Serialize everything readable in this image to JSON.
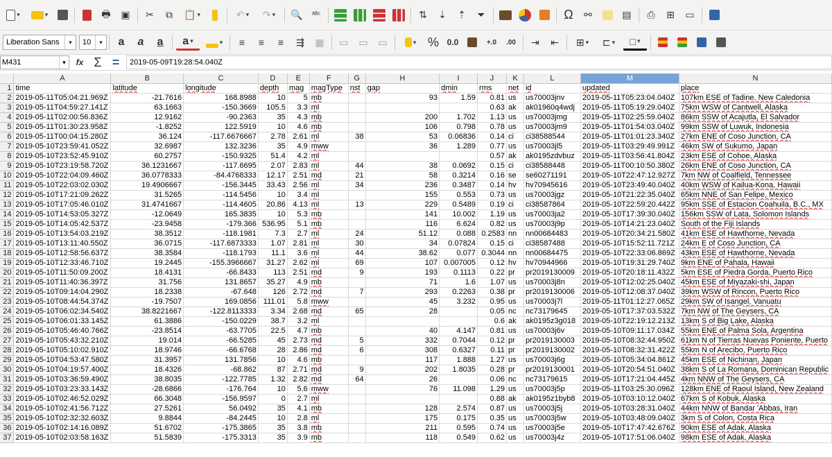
{
  "toolbar1": {
    "icons": [
      "new-icon",
      "open-icon",
      "save-icon",
      "pdf-icon",
      "print-icon",
      "print-preview-icon",
      "cut-icon",
      "copy-icon",
      "paste-icon",
      "clone-format-icon",
      "undo-icon",
      "redo-icon",
      "find-replace-icon",
      "spelling-icon",
      "row-icon",
      "column-icon",
      "insert-rows-icon",
      "insert-columns-icon",
      "sort-icon",
      "sort-ascending-icon",
      "sort-descending-icon",
      "autofilter-icon",
      "image-icon",
      "chart-icon",
      "pivot-table-icon",
      "special-character-icon",
      "hyperlink-icon",
      "comment-icon",
      "header-footer-icon",
      "define-print-area-icon",
      "freeze-rows-icon",
      "split-window-icon",
      "show-draw-icon"
    ],
    "colors": {
      "green": "#3a9b3a",
      "red": "#c33",
      "blue": "#3465a4",
      "yellow": "#f5c211"
    }
  },
  "toolbar2": {
    "font_name": "Liberation Sans",
    "font_size": "10",
    "percent_label": "%",
    "number_label": "0.0"
  },
  "formula_bar": {
    "cell_ref": "M431",
    "sum_symbol": "Σ",
    "eq_symbol": "=",
    "fx_symbol": "fx",
    "content": "2019-05-09T19:28:54.040Z"
  },
  "grid": {
    "selected_column": "M",
    "columns": [
      {
        "letter": "A",
        "w": 140
      },
      {
        "letter": "B",
        "w": 105
      },
      {
        "letter": "C",
        "w": 108
      },
      {
        "letter": "D",
        "w": 42
      },
      {
        "letter": "E",
        "w": 32
      },
      {
        "letter": "F",
        "w": 56
      },
      {
        "letter": "G",
        "w": 25
      },
      {
        "letter": "H",
        "w": 107
      },
      {
        "letter": "I",
        "w": 55
      },
      {
        "letter": "J",
        "w": 42
      },
      {
        "letter": "K",
        "w": 25
      },
      {
        "letter": "L",
        "w": 82
      },
      {
        "letter": "M",
        "w": 142
      },
      {
        "letter": "N",
        "w": 220
      }
    ],
    "rows": [
      {
        "n": "1",
        "c": [
          "time",
          "latitude",
          "longitude",
          "depth",
          "mag",
          "magType",
          "nst",
          "gap",
          "dmin",
          "rms",
          "net",
          "id",
          "updated",
          "place"
        ]
      },
      {
        "n": "2",
        "c": [
          "2019-05-11T05:04:21.969Z",
          "-21.7616",
          "168.8988",
          "10",
          "5",
          "mb",
          "",
          "93",
          "1.59",
          "0.81",
          "us",
          "us70003jnv",
          "2019-05-11T05:23:04.040Z",
          "107km ESE of Tadine, New Caledonia"
        ]
      },
      {
        "n": "3",
        "c": [
          "2019-05-11T04:59:27.141Z",
          "63.1663",
          "-150.3669",
          "105.5",
          "3.3",
          "ml",
          "",
          "",
          "",
          "0.63",
          "ak",
          "ak01960q4wdj",
          "2019-05-11T05:19:29.040Z",
          "75km WSW of Cantwell, Alaska"
        ]
      },
      {
        "n": "4",
        "c": [
          "2019-05-11T02:00:56.836Z",
          "12.9162",
          "-90.2363",
          "35",
          "4.3",
          "mb",
          "",
          "200",
          "1.702",
          "1.13",
          "us",
          "us70003jmg",
          "2019-05-11T02:25:59.040Z",
          "86km SSW of Acajutla, El Salvador"
        ]
      },
      {
        "n": "5",
        "c": [
          "2019-05-11T01:30:23.958Z",
          "-1.8252",
          "122.5919",
          "10",
          "4.6",
          "mb",
          "",
          "106",
          "0.798",
          "0.78",
          "us",
          "us70003jm9",
          "2019-05-11T01:54:03.040Z",
          "99km SSW of Luwuk, Indonesia"
        ]
      },
      {
        "n": "6",
        "c": [
          "2019-05-11T00:04:15.280Z",
          "36.124",
          "-117.6676667",
          "2.78",
          "2.61",
          "ml",
          "38",
          "53",
          "0.06836",
          "0.14",
          "ci",
          "ci38588544",
          "2019-05-11T01:01:23.340Z",
          "27km ENE of Coso Junction, CA"
        ]
      },
      {
        "n": "7",
        "c": [
          "2019-05-10T23:59:41.052Z",
          "32.6987",
          "132.3236",
          "35",
          "4.9",
          "mww",
          "",
          "36",
          "1.289",
          "0.77",
          "us",
          "us70003jl5",
          "2019-05-11T03:29:49.991Z",
          "46km SW of Sukumo, Japan"
        ]
      },
      {
        "n": "8",
        "c": [
          "2019-05-10T23:52:45.910Z",
          "60.2757",
          "-150.9325",
          "51.4",
          "4.2",
          "ml",
          "",
          "",
          "",
          "0.57",
          "ak",
          "ak0195zdvbuz",
          "2019-05-11T03:56:41.804Z",
          "23km ESE of Cohoe, Alaska"
        ]
      },
      {
        "n": "9",
        "c": [
          "2019-05-10T23:19:58.720Z",
          "36.1231667",
          "-117.6695",
          "2.07",
          "2.83",
          "ml",
          "44",
          "38",
          "0.0692",
          "0.15",
          "ci",
          "ci38588448",
          "2019-05-11T00:10:50.380Z",
          "26km ENE of Coso Junction, CA"
        ]
      },
      {
        "n": "10",
        "c": [
          "2019-05-10T22:04:09.460Z",
          "36.0778333",
          "-84.4768333",
          "12.17",
          "2.51",
          "md",
          "21",
          "58",
          "0.3214",
          "0.16",
          "se",
          "se60271191",
          "2019-05-10T22:47:12.927Z",
          "7km NW of Coalfield, Tennessee"
        ]
      },
      {
        "n": "11",
        "c": [
          "2019-05-10T22:03:02.030Z",
          "19.4906667",
          "-156.3445",
          "33.43",
          "2.56",
          "ml",
          "34",
          "236",
          "0.3487",
          "0.14",
          "hv",
          "hv70945616",
          "2019-05-10T23:49:40.040Z",
          "40km WSW of Kailua-Kona, Hawaii"
        ]
      },
      {
        "n": "12",
        "c": [
          "2019-05-10T17:21:09.262Z",
          "31.5265",
          "-114.5456",
          "10",
          "3.4",
          "ml",
          "",
          "155",
          "0.553",
          "0.73",
          "us",
          "us70003jgz",
          "2019-05-10T21:22:35.040Z",
          "65km NNE of San Felipe, Mexico"
        ]
      },
      {
        "n": "13",
        "c": [
          "2019-05-10T17:05:46.010Z",
          "31.4741667",
          "-114.4605",
          "20.86",
          "4.13",
          "ml",
          "13",
          "229",
          "0.5489",
          "0.19",
          "ci",
          "ci38587864",
          "2019-05-10T22:59:20.442Z",
          "95km SSE of Estacion Coahuila, B.C., MX"
        ]
      },
      {
        "n": "14",
        "c": [
          "2019-05-10T14:53:05.327Z",
          "-12.0649",
          "165.3835",
          "10",
          "5.3",
          "mb",
          "",
          "141",
          "10.002",
          "1.19",
          "us",
          "us70003ja2",
          "2019-05-10T17:39:30.040Z",
          "156km SSW of Lata, Solomon Islands"
        ]
      },
      {
        "n": "15",
        "c": [
          "2019-05-10T14:05:42.537Z",
          "-23.9458",
          "-179.366",
          "536.95",
          "5.1",
          "mb",
          "",
          "116",
          "6.624",
          "0.82",
          "us",
          "us70003j9p",
          "2019-05-10T14:21:23.040Z",
          "South of the Fiji Islands"
        ]
      },
      {
        "n": "16",
        "c": [
          "2019-05-10T13:54:03.219Z",
          "38.3512",
          "-118.1981",
          "7.3",
          "2.7",
          "ml",
          "24",
          "51.12",
          "0.088",
          "0.2583",
          "nn",
          "nn00684483",
          "2019-05-10T20:34:21.580Z",
          "41km ESE of Hawthorne, Nevada"
        ]
      },
      {
        "n": "17",
        "c": [
          "2019-05-10T13:11:40.550Z",
          "36.0715",
          "-117.6873333",
          "1.07",
          "2.81",
          "ml",
          "30",
          "34",
          "0.07824",
          "0.15",
          "ci",
          "ci38587488",
          "2019-05-10T15:52:11.721Z",
          "24km E of Coso Junction, CA"
        ]
      },
      {
        "n": "18",
        "c": [
          "2019-05-10T12:58:56.637Z",
          "38.3584",
          "-118.1793",
          "11.1",
          "3.6",
          "ml",
          "44",
          "38.62",
          "0.077",
          "0.3044",
          "nn",
          "nn00684475",
          "2019-05-10T22:33:06.869Z",
          "43km ESE of Hawthorne, Nevada"
        ]
      },
      {
        "n": "19",
        "c": [
          "2019-05-10T12:33:46.710Z",
          "19.2445",
          "-155.3966667",
          "31.27",
          "2.62",
          "ml",
          "69",
          "107",
          "0.007005",
          "0.12",
          "hv",
          "hv70944966",
          "2019-05-10T19:31:29.740Z",
          "9km ENE of Pahala, Hawaii"
        ]
      },
      {
        "n": "20",
        "c": [
          "2019-05-10T11:50:09.200Z",
          "18.4131",
          "-66.8433",
          "113",
          "2.51",
          "md",
          "9",
          "193",
          "0.1113",
          "0.22",
          "pr",
          "pr2019130009",
          "2019-05-10T20:18:11.432Z",
          "5km ESE of Piedra Gorda, Puerto Rico"
        ]
      },
      {
        "n": "21",
        "c": [
          "2019-05-10T11:40:36.397Z",
          "31.756",
          "131.8657",
          "35.27",
          "4.9",
          "mb",
          "",
          "71",
          "1.6",
          "1.07",
          "us",
          "us70003j8n",
          "2019-05-10T12:02:25.040Z",
          "45km ESE of Miyazaki-shi, Japan"
        ]
      },
      {
        "n": "22",
        "c": [
          "2019-05-10T09:14:04.290Z",
          "18.2338",
          "-67.648",
          "126",
          "2.72",
          "md",
          "7",
          "293",
          "0.2263",
          "0.38",
          "pr",
          "pr2019130006",
          "2019-05-10T12:08:37.040Z",
          "39km WSW of Rincon, Puerto Rico"
        ]
      },
      {
        "n": "23",
        "c": [
          "2019-05-10T08:44:54.374Z",
          "-19.7507",
          "169.0856",
          "111.01",
          "5.8",
          "mww",
          "",
          "45",
          "3.232",
          "0.95",
          "us",
          "us70003j7l",
          "2019-05-11T01:12:27.065Z",
          "29km SW of Isangel, Vanuatu"
        ]
      },
      {
        "n": "24",
        "c": [
          "2019-05-10T06:02:34.540Z",
          "38.8221667",
          "-122.8113333",
          "3.34",
          "2.68",
          "md",
          "65",
          "28",
          "",
          "0.05",
          "nc",
          "nc73179645",
          "2019-05-10T17:37:03.532Z",
          "7km NW of The Geysers, CA"
        ]
      },
      {
        "n": "25",
        "c": [
          "2019-05-10T06:01:33.145Z",
          "61.3886",
          "-150.0229",
          "38.7",
          "3.2",
          "ml",
          "",
          "",
          "",
          "0.6",
          "ak",
          "ak0195z3g018",
          "2019-05-10T22:19:12.213Z",
          "13km S of Big Lake, Alaska"
        ]
      },
      {
        "n": "26",
        "c": [
          "2019-05-10T05:46:40.766Z",
          "-23.8514",
          "-63.7705",
          "22.5",
          "4.7",
          "mb",
          "",
          "40",
          "4.147",
          "0.81",
          "us",
          "us70003j6v",
          "2019-05-10T09:11:17.034Z",
          "55km ENE of Palma Sola, Argentina"
        ]
      },
      {
        "n": "27",
        "c": [
          "2019-05-10T05:43:32.210Z",
          "19.014",
          "-66.5285",
          "45",
          "2.73",
          "md",
          "5",
          "332",
          "0.7044",
          "0.12",
          "pr",
          "pr2019130003",
          "2019-05-10T08:32:44.950Z",
          "61km N of Tierras Nuevas Poniente, Puerto"
        ]
      },
      {
        "n": "28",
        "c": [
          "2019-05-10T05:10:02.910Z",
          "18.9746",
          "-66.6768",
          "28",
          "2.86",
          "md",
          "6",
          "308",
          "0.6327",
          "0.11",
          "pr",
          "pr2019130002",
          "2019-05-10T08:32:31.422Z",
          "55km N of Arecibo, Puerto Rico"
        ]
      },
      {
        "n": "29",
        "c": [
          "2019-05-10T04:53:47.580Z",
          "31.3957",
          "131.7856",
          "10",
          "4.6",
          "mb",
          "",
          "117",
          "1.888",
          "1.27",
          "us",
          "us70003j6g",
          "2019-05-10T05:34:04.861Z",
          "45km ESE of Nichinan, Japan"
        ]
      },
      {
        "n": "30",
        "c": [
          "2019-05-10T04:19:57.400Z",
          "18.4326",
          "-68.862",
          "87",
          "2.71",
          "md",
          "9",
          "202",
          "1.8035",
          "0.28",
          "pr",
          "pr2019130001",
          "2019-05-10T20:54:51.040Z",
          "38km S of La Romana, Dominican Republic"
        ]
      },
      {
        "n": "31",
        "c": [
          "2019-05-10T03:36:59.490Z",
          "38.8035",
          "-122.7785",
          "1.32",
          "2.82",
          "md",
          "64",
          "26",
          "",
          "0.06",
          "nc",
          "nc73179615",
          "2019-05-10T17:21:04.445Z",
          "4km NNW of The Geysers, CA"
        ]
      },
      {
        "n": "32",
        "c": [
          "2019-05-10T03:23:33.143Z",
          "-28.6866",
          "-176.764",
          "10",
          "5.6",
          "mww",
          "",
          "76",
          "11.098",
          "1.29",
          "us",
          "us70003j5p",
          "2019-05-11T03:25:30.096Z",
          "128km ENE of Raoul Island, New Zealand"
        ]
      },
      {
        "n": "33",
        "c": [
          "2019-05-10T02:46:52.029Z",
          "66.3048",
          "-156.9597",
          "0",
          "2.7",
          "ml",
          "",
          "",
          "",
          "0.88",
          "ak",
          "ak0195z1byb8",
          "2019-05-10T03:10:12.040Z",
          "67km S of Kobuk, Alaska"
        ]
      },
      {
        "n": "34",
        "c": [
          "2019-05-10T02:41:56.712Z",
          "27.5261",
          "56.0492",
          "35",
          "4.1",
          "mb",
          "",
          "128",
          "2.574",
          "0.87",
          "us",
          "us70003j5j",
          "2019-05-10T03:28:31.040Z",
          "44km NNW of Bandar 'Abbas, Iran"
        ]
      },
      {
        "n": "35",
        "c": [
          "2019-05-10T02:32:32.603Z",
          "9.8844",
          "-84.2445",
          "10",
          "2.8",
          "ml",
          "",
          "175",
          "0.175",
          "0.35",
          "us",
          "us70003j5w",
          "2019-05-10T03:48:09.040Z",
          "3km S of Colon, Costa Rica"
        ]
      },
      {
        "n": "36",
        "c": [
          "2019-05-10T02:14:16.089Z",
          "51.6702",
          "-175.3865",
          "35",
          "3.8",
          "mb",
          "",
          "211",
          "0.595",
          "0.74",
          "us",
          "us70003j5e",
          "2019-05-10T17:47:42.676Z",
          "90km ESE of Adak, Alaska"
        ]
      },
      {
        "n": "37",
        "c": [
          "2019-05-10T02:03:58.163Z",
          "51.5839",
          "-175.3313",
          "35",
          "3.9",
          "mb",
          "",
          "118",
          "0.549",
          "0.62",
          "us",
          "us70003j4z",
          "2019-05-10T17:51:06.040Z",
          "98km ESE of Adak, Alaska"
        ]
      }
    ],
    "numeric_cols": [
      1,
      2,
      3,
      4,
      6,
      7,
      8,
      9
    ],
    "underlined_cols": [
      5,
      13
    ]
  }
}
